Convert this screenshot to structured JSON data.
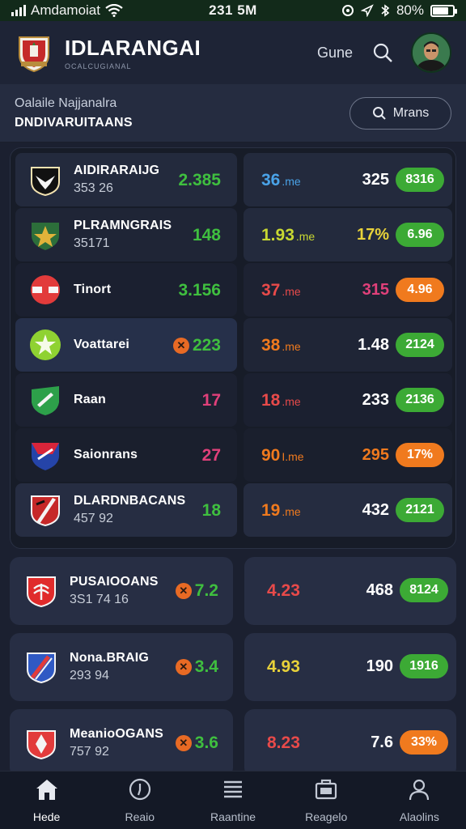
{
  "status_bar": {
    "carrier": "Amdamoiat",
    "time": "231 5M",
    "battery": "80%",
    "battery_level": 0.8
  },
  "app_bar": {
    "title": "IDLARANGAI",
    "subtitle": "OCALCUGIANAL",
    "game_label": "Gune"
  },
  "sub_bar": {
    "line1": "Oalaile Najjanalra",
    "line2": "DNDIVARUITAANS",
    "button_label": "Mrans"
  },
  "colors": {
    "green": "#3fbf3f",
    "blue": "#4aa3e8",
    "red": "#e84a4a",
    "magenta": "#e0407a",
    "orange": "#f07a1e",
    "yellow": "#e8d23a",
    "lime": "#c8d832",
    "pill_green": "#3caa35",
    "pill_orange": "#f07a1e"
  },
  "panel_rows": [
    {
      "name": "AIDIRARAIJG",
      "sub": "353 26",
      "score": "2.385",
      "score_color": "#3fbf3f",
      "odd1": "36",
      "odd1_unit": ".me",
      "odd1_color": "#4aa3e8",
      "odd2": "325",
      "odd2_color": "#ffffff",
      "pill": "8316",
      "pill_color": "#3caa35",
      "badge": "eagle-badge-icon",
      "has_x": false
    },
    {
      "name": "PLRAMNGRAIS",
      "sub": "35171",
      "score": "148",
      "score_color": "#3fbf3f",
      "odd1": "1.93",
      "odd1_unit": ".me",
      "odd1_color": "#c8d832",
      "odd2": "17%",
      "odd2_color": "#e8d23a",
      "pill": "6.96",
      "pill_color": "#3caa35",
      "badge": "green-shield-icon",
      "has_x": false
    },
    {
      "name": "Tinort",
      "sub": "",
      "score": "3.156",
      "score_color": "#3fbf3f",
      "odd1": "37",
      "odd1_unit": ".me",
      "odd1_color": "#e84a4a",
      "odd2": "315",
      "odd2_color": "#e0407a",
      "pill": "4.96",
      "pill_color": "#f07a1e",
      "badge": "red-cross-icon",
      "has_x": false
    },
    {
      "name": "Voattarei",
      "sub": "",
      "score": "223",
      "score_color": "#3fbf3f",
      "odd1": "38",
      "odd1_unit": ".me",
      "odd1_color": "#f07a1e",
      "odd2": "1.48",
      "odd2_color": "#ffffff",
      "pill": "2124",
      "pill_color": "#3caa35",
      "badge": "lime-star-icon",
      "has_x": true
    },
    {
      "name": "Raan",
      "sub": "",
      "score": "17",
      "score_color": "#e0407a",
      "odd1": "18",
      "odd1_unit": ".me",
      "odd1_color": "#e84a4a",
      "odd2": "233",
      "odd2_color": "#ffffff",
      "pill": "2136",
      "pill_color": "#3caa35",
      "badge": "green-arrow-icon",
      "has_x": false
    },
    {
      "name": "Saionrans",
      "sub": "",
      "score": "27",
      "score_color": "#e0407a",
      "odd1": "90",
      "odd1_unit": "I.me",
      "odd1_color": "#f07a1e",
      "odd2": "295",
      "odd2_color": "#f07a1e",
      "pill": "17%",
      "pill_color": "#f07a1e",
      "badge": "blue-crest-icon",
      "has_x": false
    },
    {
      "name": "DLARDNBACANS",
      "sub": "457 92",
      "score": "18",
      "score_color": "#3fbf3f",
      "odd1": "19",
      "odd1_unit": ".me",
      "odd1_color": "#f07a1e",
      "odd2": "432",
      "odd2_color": "#ffffff",
      "pill": "2121",
      "pill_color": "#3caa35",
      "badge": "red-slash-shield-icon",
      "has_x": false
    }
  ],
  "card_rows": [
    {
      "name": "PUSAIOOANS",
      "sub": "3S1 74 16",
      "score": "7.2",
      "score_color": "#3fbf3f",
      "odd1": "4.23",
      "odd1_color": "#e84a4a",
      "odd2": "468",
      "odd2_color": "#ffffff",
      "pill": "8124",
      "pill_color": "#3caa35",
      "badge": "red-palm-shield-icon"
    },
    {
      "name": "Nona.BRAIG",
      "sub": "293 94",
      "score": "3.4",
      "score_color": "#3fbf3f",
      "odd1": "4.93",
      "odd1_color": "#e8d23a",
      "odd2": "190",
      "odd2_color": "#ffffff",
      "pill": "1916",
      "pill_color": "#3caa35",
      "badge": "blue-red-shield-icon"
    },
    {
      "name": "MeanioOGANS",
      "sub": "757 92",
      "score": "3.6",
      "score_color": "#3fbf3f",
      "odd1": "8.23",
      "odd1_color": "#e84a4a",
      "odd2": "7.6",
      "odd2_color": "#ffffff",
      "pill": "33%",
      "pill_color": "#f07a1e",
      "badge": "red-shield-icon"
    }
  ],
  "tabs": [
    {
      "label": "Hede",
      "icon": "home-icon"
    },
    {
      "label": "Reaio",
      "icon": "clock-icon"
    },
    {
      "label": "Raantine",
      "icon": "list-icon"
    },
    {
      "label": "Reagelo",
      "icon": "briefcase-icon"
    },
    {
      "label": "Alaolins",
      "icon": "user-icon"
    }
  ]
}
